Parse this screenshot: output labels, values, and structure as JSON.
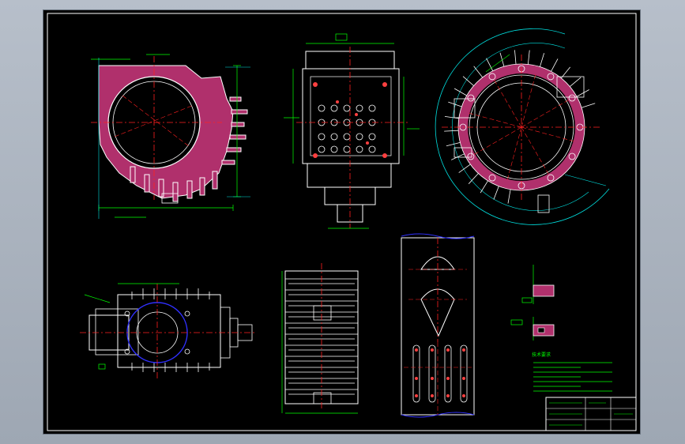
{
  "colors": {
    "background_canvas": "#aab2bd",
    "sheet": "#000000",
    "outline": "#ffffff",
    "dimension": "#00ff00",
    "centerline": "#ff2020",
    "hatch": "#b0306c",
    "construction": "#00e0e0",
    "hidden": "#ffff00",
    "blue": "#3030ff",
    "magenta": "#ff40ff"
  },
  "views": [
    {
      "id": "top-left",
      "name": "finned-housing-front-view"
    },
    {
      "id": "top-middle",
      "name": "flange-section-view"
    },
    {
      "id": "top-right",
      "name": "circular-finned-plan-view"
    },
    {
      "id": "bottom-left",
      "name": "housing-top-view"
    },
    {
      "id": "bottom-middle",
      "name": "finned-block-side-view"
    },
    {
      "id": "bottom-right-tool",
      "name": "cutter-and-hole-pattern-view"
    },
    {
      "id": "details",
      "name": "detail-sections"
    }
  ],
  "notes": {
    "heading": "技术要求"
  }
}
